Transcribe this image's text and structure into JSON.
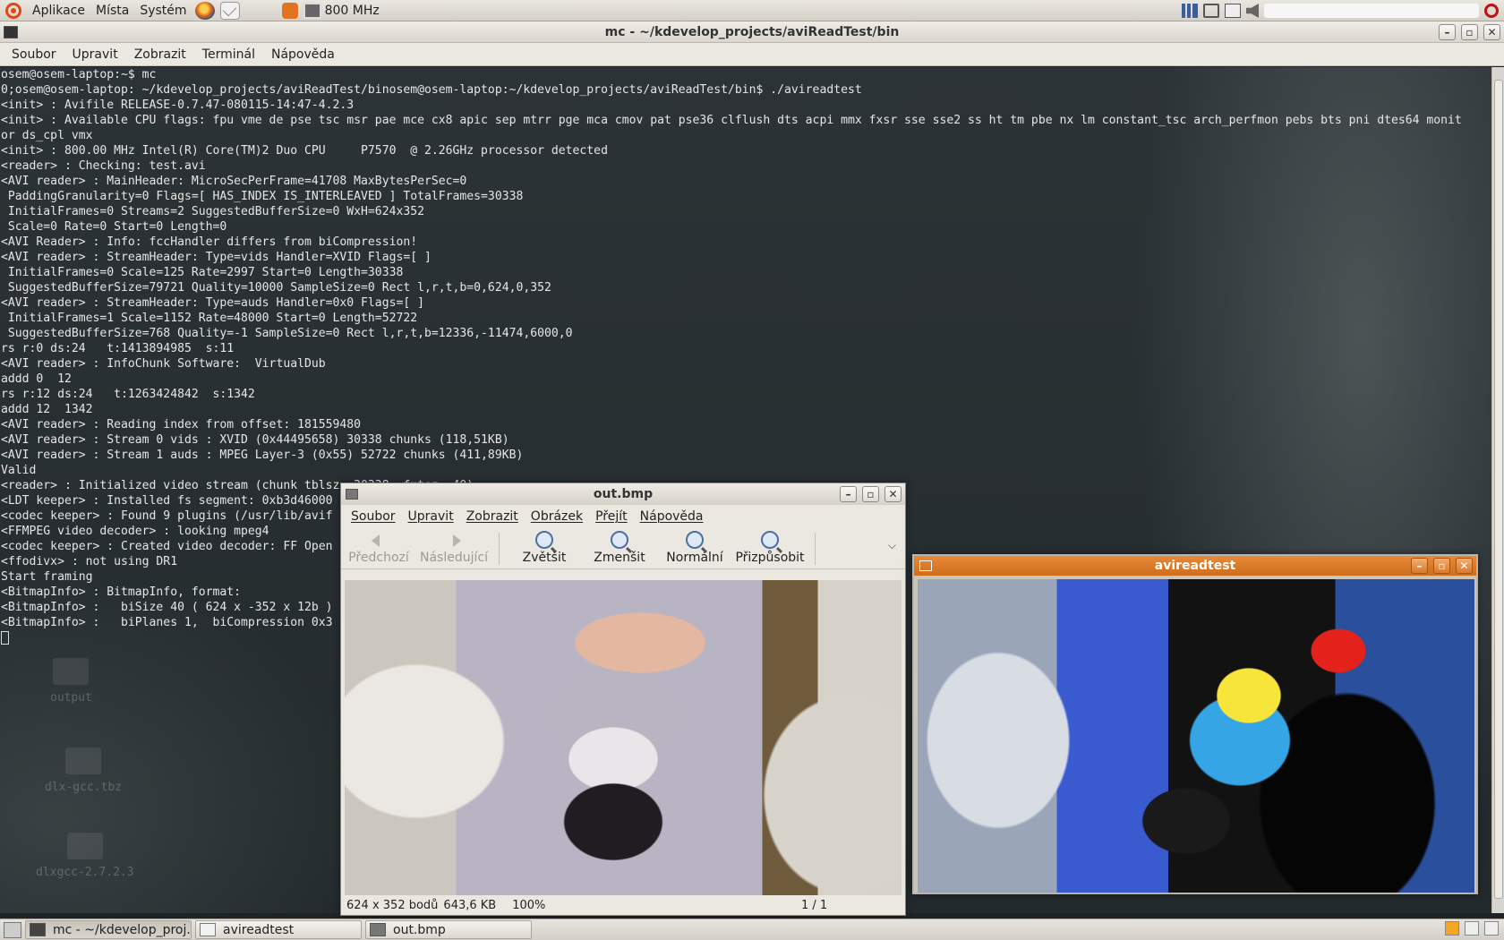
{
  "top_panel": {
    "menus": [
      "Aplikace",
      "Místa",
      "Systém"
    ],
    "cpu_freq": "800 MHz",
    "icons": [
      "ubuntu-logo",
      "firefox-icon",
      "mail-icon",
      "cpu-freq-icon"
    ]
  },
  "terminal": {
    "title": "mc - ~/kdevelop_projects/aviReadTest/bin",
    "menus": [
      "Soubor",
      "Upravit",
      "Zobrazit",
      "Terminál",
      "Nápověda"
    ],
    "lines": [
      "osem@osem-laptop:~$ mc",
      "0;osem@osem-laptop: ~/kdevelop_projects/aviReadTest/binosem@osem-laptop:~/kdevelop_projects/aviReadTest/bin$ ./avireadtest",
      "<init> : Avifile RELEASE-0.7.47-080115-14:47-4.2.3",
      "<init> : Available CPU flags: fpu vme de pse tsc msr pae mce cx8 apic sep mtrr pge mca cmov pat pse36 clflush dts acpi mmx fxsr sse sse2 ss ht tm pbe nx lm constant_tsc arch_perfmon pebs bts pni dtes64 monit",
      "or ds_cpl vmx",
      "<init> : 800.00 MHz Intel(R) Core(TM)2 Duo CPU     P7570  @ 2.26GHz processor detected",
      "<reader> : Checking: test.avi",
      "<AVI reader> : MainHeader: MicroSecPerFrame=41708 MaxBytesPerSec=0",
      " PaddingGranularity=0 Flags=[ HAS_INDEX IS_INTERLEAVED ] TotalFrames=30338",
      " InitialFrames=0 Streams=2 SuggestedBufferSize=0 WxH=624x352",
      " Scale=0 Rate=0 Start=0 Length=0",
      "<AVI Reader> : Info: fccHandler differs from biCompression!",
      "<AVI reader> : StreamHeader: Type=vids Handler=XVID Flags=[ ]",
      " InitialFrames=0 Scale=125 Rate=2997 Start=0 Length=30338",
      " SuggestedBufferSize=79721 Quality=10000 SampleSize=0 Rect l,r,t,b=0,624,0,352",
      "<AVI reader> : StreamHeader: Type=auds Handler=0x0 Flags=[ ]",
      " InitialFrames=1 Scale=1152 Rate=48000 Start=0 Length=52722",
      " SuggestedBufferSize=768 Quality=-1 SampleSize=0 Rect l,r,t,b=12336,-11474,6000,0",
      "rs r:0 ds:24   t:1413894985  s:11",
      "<AVI reader> : InfoChunk Software:  VirtualDub",
      "addd 0  12",
      "rs r:12 ds:24   t:1263424842  s:1342",
      "addd 12  1342",
      "<AVI reader> : Reading index from offset: 181559480",
      "<AVI reader> : Stream 0 vids : XVID (0x44495658) 30338 chunks (118,51KB)",
      "<AVI reader> : Stream 1 auds : MPEG Layer-3 (0x55) 52722 chunks (411,89KB)",
      "Valid",
      "<reader> : Initialized video stream (chunk tblsz: 30338, fmtsz: 40)",
      "<LDT keeper> : Installed fs segment: 0xb3d46000",
      "<codec keeper> : Found 9 plugins (/usr/lib/avif",
      "<FFMPEG video decoder> : looking mpeg4",
      "<codec keeper> : Created video decoder: FF Open",
      "<ffodivx> : not using DR1",
      "Start framing",
      "<BitmapInfo> : BitmapInfo, format:",
      "<BitmapInfo> :   biSize 40 ( 624 x -352 x 12b )",
      "<BitmapInfo> :   biPlanes 1,  biCompression 0x3"
    ]
  },
  "desktop": {
    "icons": [
      "output",
      "dlx-gcc.tbz",
      "dlxgcc-2.7.2.3"
    ]
  },
  "image_viewer": {
    "title": "out.bmp",
    "menus": [
      "Soubor",
      "Upravit",
      "Zobrazit",
      "Obrázek",
      "Přejít",
      "Nápověda"
    ],
    "toolbar": {
      "prev": "Předchozí",
      "next": "Následující",
      "zoom_in": "Zvětšit",
      "zoom_out": "Zmenšit",
      "normal": "Normální",
      "fit": "Přizpůsobit"
    },
    "status": {
      "dims": "624 x 352 bodů",
      "size": "643,6 KB",
      "zoom": "100%",
      "page": "1 / 1"
    }
  },
  "avi_window": {
    "title": "avireadtest"
  },
  "taskbar": {
    "tasks": [
      "mc - ~/kdevelop_proj...",
      "avireadtest",
      "out.bmp"
    ]
  }
}
